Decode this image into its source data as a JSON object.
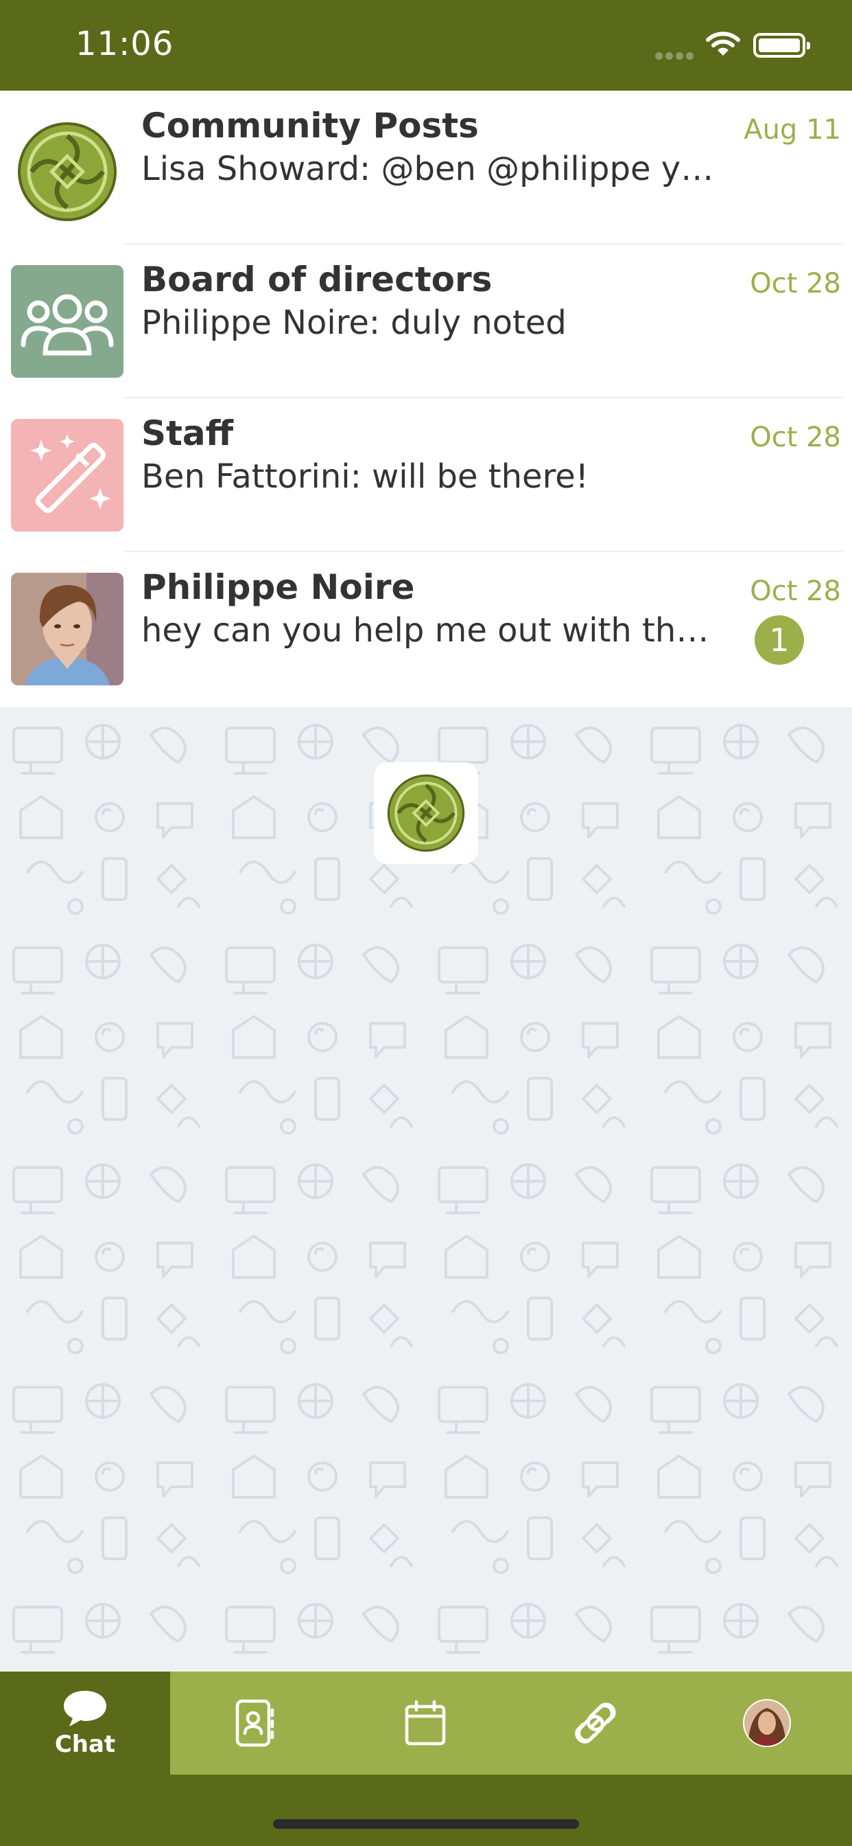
{
  "status_bar": {
    "time": "11:06"
  },
  "chats": [
    {
      "title": "Community Posts",
      "preview": "Lisa Showard: @ben @philippe you...",
      "date": "Aug 11",
      "avatar": "community-logo-icon"
    },
    {
      "title": "Board of directors",
      "preview": "Philippe Noire: duly noted",
      "date": "Oct 28",
      "avatar": "group-people-icon"
    },
    {
      "title": "Staff",
      "preview": "Ben Fattorini: will be there!",
      "date": "Oct 28",
      "avatar": "magic-wand-icon"
    },
    {
      "title": "Philippe Noire",
      "preview": "hey can you help me out with the ...",
      "date": "Oct 28",
      "unread": "1",
      "avatar": "user-photo"
    }
  ],
  "tabs": [
    {
      "label": "Chat",
      "icon": "chat-bubble-icon",
      "active": true
    },
    {
      "label": "",
      "icon": "contacts-book-icon"
    },
    {
      "label": "",
      "icon": "calendar-icon"
    },
    {
      "label": "",
      "icon": "link-icon"
    },
    {
      "label": "",
      "icon": "profile-avatar"
    }
  ],
  "colors": {
    "header_green": "#5a6a18",
    "accent_green": "#9bb04a",
    "board_avatar": "#84a98c",
    "staff_avatar": "#f4b3b5"
  }
}
